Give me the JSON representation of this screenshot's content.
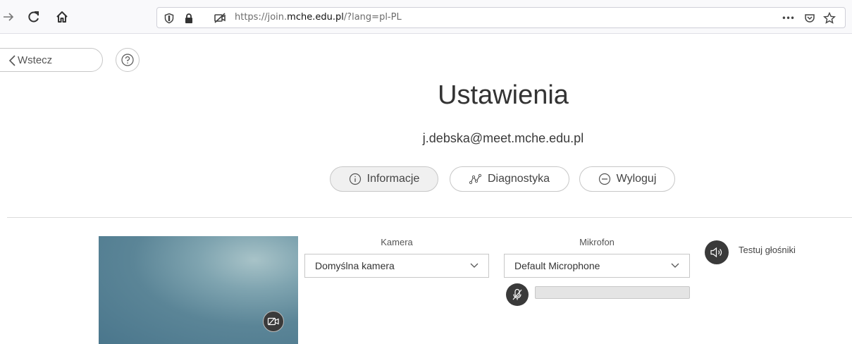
{
  "browser": {
    "url_prefix": "https://join.",
    "url_host": "mche.edu.pl",
    "url_suffix": "/?lang=pl-PL",
    "menu_dots": "•••"
  },
  "nav": {
    "back_label": "Wstecz",
    "help_icon": "help-circle-icon"
  },
  "page": {
    "title": "Ustawienia",
    "email": "j.debska@meet.mche.edu.pl"
  },
  "actions": [
    {
      "label": "Informacje",
      "icon": "info-icon"
    },
    {
      "label": "Diagnostyka",
      "icon": "diagnostics-icon"
    },
    {
      "label": "Wyloguj",
      "icon": "minus-circle-icon"
    }
  ],
  "devices": {
    "camera_label": "Kamera",
    "camera_value": "Domyślna kamera",
    "microphone_label": "Mikrofon",
    "microphone_value": "Default Microphone",
    "microphone_level": 0,
    "speaker_test_label": "Testuj głośniki"
  }
}
